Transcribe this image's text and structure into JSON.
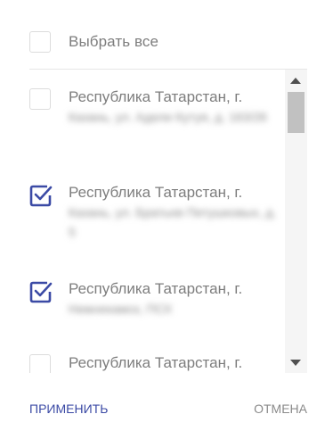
{
  "select_all": {
    "label": "Выбрать все",
    "checked": false
  },
  "items": [
    {
      "title": "Республика Татарстан, г.",
      "address": "Казань, ул. Адели Кутуя, д. 163/26",
      "checked": false
    },
    {
      "title": "Республика Татарстан, г.",
      "address": "Казань, ул. Братьев Петушковых, д. 5",
      "checked": true
    },
    {
      "title": "Республика Татарстан, г.",
      "address": "Нижнекамск, ПСХ",
      "checked": true
    },
    {
      "title": "Республика Татарстан, г.",
      "address": "",
      "checked": false
    }
  ],
  "footer": {
    "apply_label": "ПРИМЕНИТЬ",
    "cancel_label": "ОТМЕНА"
  },
  "colors": {
    "accent": "#3b4aa5",
    "text": "#7d7d7d"
  }
}
